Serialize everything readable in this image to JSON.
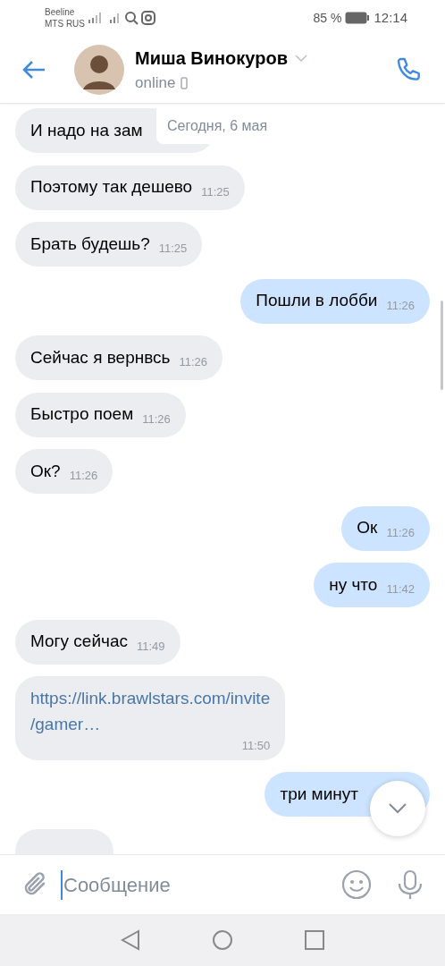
{
  "status_bar": {
    "carrier_1": "Beeline",
    "carrier_2": "MTS RUS",
    "battery": "85 %",
    "time": "12:14"
  },
  "header": {
    "name": "Миша Винокуров",
    "status": "online"
  },
  "date_pill": "Сегодня, 6 мая",
  "messages": [
    {
      "kind": "in",
      "text": "И надо на зам"
    },
    {
      "kind": "in",
      "text": "Поэтому так дешево",
      "time": "11:25"
    },
    {
      "kind": "in",
      "text": "Брать будешь?",
      "time": "11:25"
    },
    {
      "kind": "out",
      "text": "Пошли в лобби",
      "time": "11:26"
    },
    {
      "kind": "in",
      "text": "Сейчас я вернвсь",
      "time": "11:26"
    },
    {
      "kind": "in",
      "text": "Быстро поем",
      "time": "11:26"
    },
    {
      "kind": "in",
      "text": "Ок?",
      "time": "11:26"
    },
    {
      "kind": "out",
      "text": "Ок",
      "time": "11:26"
    },
    {
      "kind": "out",
      "text": "ну что",
      "time": "11:42"
    },
    {
      "kind": "in",
      "text": "Могу сейчас",
      "time": "11:49"
    },
    {
      "kind": "link",
      "text": "https://link.brawlstars.com/invite\n/gamer…",
      "time": "11:50"
    },
    {
      "kind": "out",
      "text": "три минут"
    },
    {
      "kind": "in"
    }
  ],
  "input": {
    "placeholder": "Сообщение"
  }
}
